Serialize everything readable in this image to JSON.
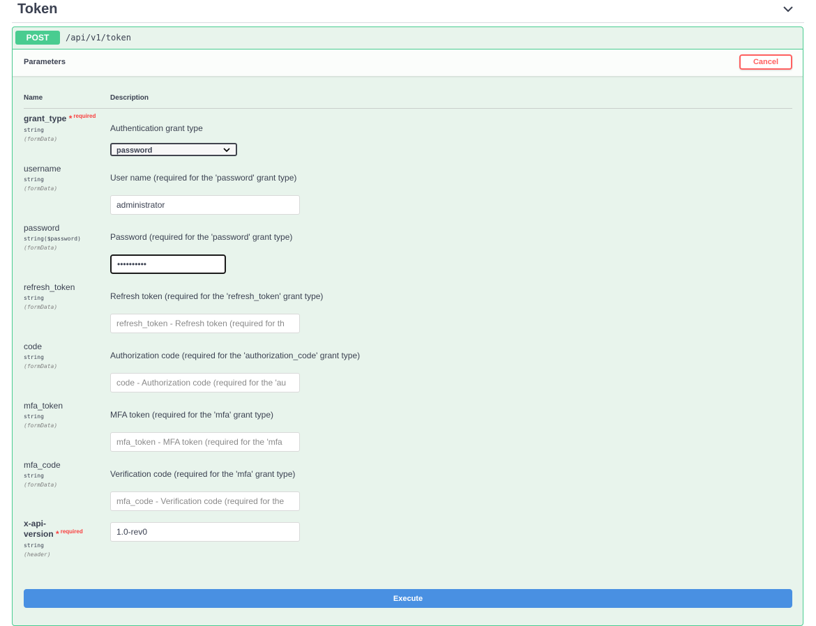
{
  "tag": {
    "title": "Token",
    "toggle_icon": "chevron-down-icon"
  },
  "operation": {
    "method": "POST",
    "path": "/api/v1/token"
  },
  "parameters_section": {
    "title": "Parameters",
    "cancel_label": "Cancel"
  },
  "columns": {
    "name": "Name",
    "description": "Description"
  },
  "required_label": "required",
  "params": [
    {
      "name": "grant_type",
      "required": true,
      "type": "string",
      "in": "(formData)",
      "description": "Authentication grant type",
      "control": "select",
      "value": "password"
    },
    {
      "name": "username",
      "required": false,
      "type": "string",
      "in": "(formData)",
      "description": "User name (required for the 'password' grant type)",
      "control": "input",
      "value": "administrator",
      "placeholder": ""
    },
    {
      "name": "password",
      "required": false,
      "type": "string($password)",
      "in": "(formData)",
      "description": "Password (required for the 'password' grant type)",
      "control": "password",
      "value": "••••••••••",
      "placeholder": ""
    },
    {
      "name": "refresh_token",
      "required": false,
      "type": "string",
      "in": "(formData)",
      "description": "Refresh token (required for the 'refresh_token' grant type)",
      "control": "input",
      "value": "",
      "placeholder": "refresh_token - Refresh token (required for th"
    },
    {
      "name": "code",
      "required": false,
      "type": "string",
      "in": "(formData)",
      "description": "Authorization code (required for the 'authorization_code' grant type)",
      "control": "input",
      "value": "",
      "placeholder": "code - Authorization code (required for the 'au"
    },
    {
      "name": "mfa_token",
      "required": false,
      "type": "string",
      "in": "(formData)",
      "description": "MFA token (required for the 'mfa' grant type)",
      "control": "input",
      "value": "",
      "placeholder": "mfa_token - MFA token (required for the 'mfa"
    },
    {
      "name": "mfa_code",
      "required": false,
      "type": "string",
      "in": "(formData)",
      "description": "Verification code (required for the 'mfa' grant type)",
      "control": "input",
      "value": "",
      "placeholder": "mfa_code - Verification code (required for the"
    },
    {
      "name_line1": "x-api-",
      "name_line2": "version",
      "required": true,
      "type": "string",
      "in": "(header)",
      "description": "",
      "control": "input",
      "value": "1.0-rev0",
      "placeholder": ""
    }
  ],
  "execute_label": "Execute",
  "colors": {
    "post_green": "#49cc90",
    "block_bg": "#e8f4ec",
    "cancel_red": "#ff6060",
    "execute_blue": "#4990e2",
    "required_red": "#f93e3e"
  }
}
